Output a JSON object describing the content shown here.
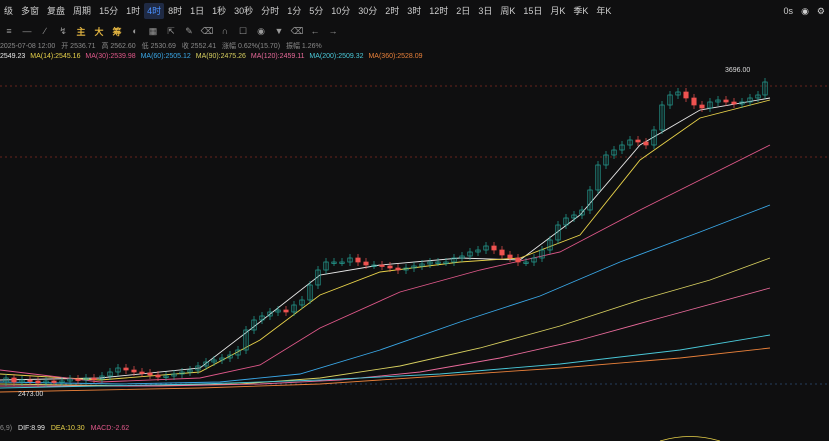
{
  "toolbar": {
    "items": [
      "级",
      "多窗",
      "复盘",
      "周期",
      "15分",
      "1时",
      "4时",
      "8时",
      "1日",
      "1秒",
      "30秒",
      "分时",
      "1分",
      "5分",
      "10分",
      "30分",
      "2时",
      "3时",
      "12时",
      "2日",
      "3日",
      "周K",
      "15日",
      "月K",
      "季K",
      "年K"
    ],
    "active": "4时",
    "right_time": "0s"
  },
  "drawing_tools": {
    "labels": [
      "主",
      "大",
      "筹"
    ]
  },
  "info": {
    "date": "2025-07-08 12:00",
    "open": "开 2536.71",
    "high": "高 2562.60",
    "low": "低 2530.69",
    "close": "收 2552.41",
    "change": "涨幅 0.62%(15.70)",
    "amplitude": "振幅 1.26%"
  },
  "ma": {
    "items": [
      {
        "label": "2549.23",
        "color": "#e8e8e8"
      },
      {
        "label": "MA(14):2545.16",
        "color": "#e8d24a"
      },
      {
        "label": "MA(30):2539.98",
        "color": "#e0588a"
      },
      {
        "label": "MA(60):2505.12",
        "color": "#3aa8e8"
      },
      {
        "label": "MA(90):2475.26",
        "color": "#d8d060"
      },
      {
        "label": "MA(120):2459.11",
        "color": "#e86a9a"
      },
      {
        "label": "MA(200):2509.32",
        "color": "#4ac8d8"
      },
      {
        "label": "MA(360):2528.09",
        "color": "#e8803a"
      }
    ]
  },
  "price_labels": {
    "high": "3696.00",
    "low": "2473.00"
  },
  "indicator": {
    "prefix": "6,9)",
    "dif": "DIF:8.99",
    "dea": "DEA:10.30",
    "macd": "MACD:-2.62",
    "dif_color": "#e8e8e8",
    "dea_color": "#e8d24a",
    "macd_color": "#e0588a"
  },
  "colors": {
    "up": "#26a69a",
    "down": "#ef5350",
    "bg": "#0f0f10"
  }
}
